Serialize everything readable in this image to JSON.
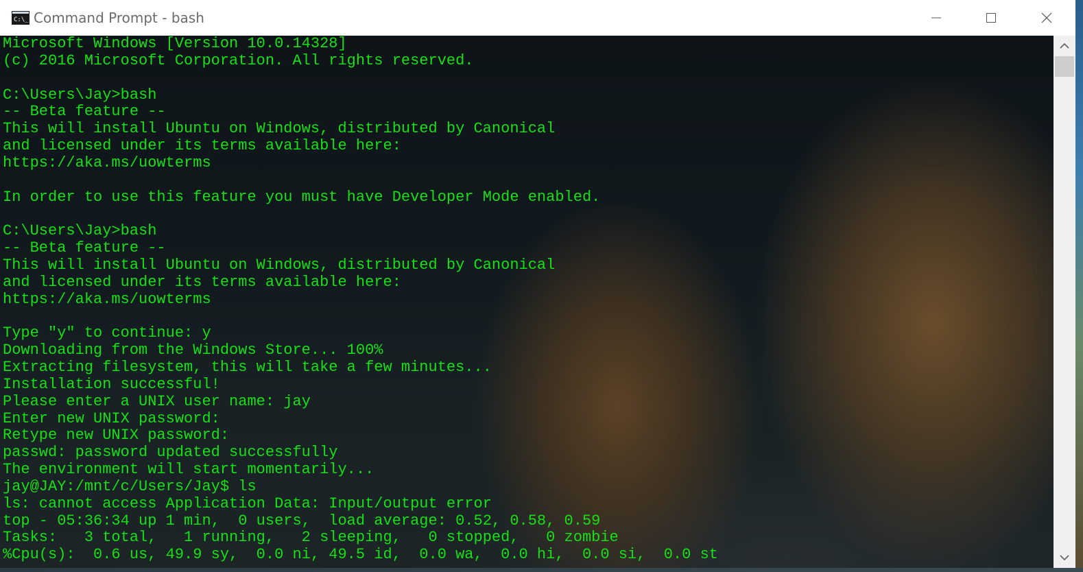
{
  "window": {
    "title": "Command Prompt - bash",
    "icon": "console-app-icon",
    "controls": {
      "minimize_icon": "minimize-icon",
      "maximize_icon": "maximize-icon",
      "close_icon": "close-icon"
    }
  },
  "terminal": {
    "text_color": "#16e016",
    "lines": [
      "Microsoft Windows [Version 10.0.14328]",
      "(c) 2016 Microsoft Corporation. All rights reserved.",
      "",
      "C:\\Users\\Jay>bash",
      "-- Beta feature --",
      "This will install Ubuntu on Windows, distributed by Canonical",
      "and licensed under its terms available here:",
      "https://aka.ms/uowterms",
      "",
      "In order to use this feature you must have Developer Mode enabled.",
      "",
      "C:\\Users\\Jay>bash",
      "-- Beta feature --",
      "This will install Ubuntu on Windows, distributed by Canonical",
      "and licensed under its terms available here:",
      "https://aka.ms/uowterms",
      "",
      "Type \"y\" to continue: y",
      "Downloading from the Windows Store... 100%",
      "Extracting filesystem, this will take a few minutes...",
      "Installation successful!",
      "Please enter a UNIX user name: jay",
      "Enter new UNIX password:",
      "Retype new UNIX password:",
      "passwd: password updated successfully",
      "The environment will start momentarily...",
      "jay@JAY:/mnt/c/Users/Jay$ ls",
      "ls: cannot access Application Data: Input/output error",
      "top - 05:36:34 up 1 min,  0 users,  load average: 0.52, 0.58, 0.59",
      "Tasks:   3 total,   1 running,   2 sleeping,   0 stopped,   0 zombie",
      "%Cpu(s):  0.6 us, 49.9 sy,  0.0 ni, 49.5 id,  0.0 wa,  0.0 hi,  0.0 si,  0.0 st"
    ]
  },
  "scrollbar": {
    "up_icon": "scroll-up-arrow-icon",
    "down_icon": "scroll-down-arrow-icon"
  }
}
